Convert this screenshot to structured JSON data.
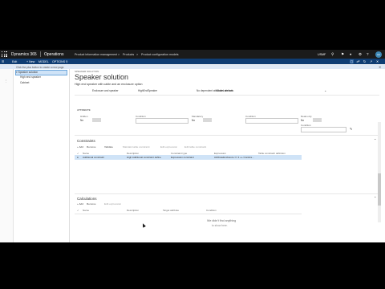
{
  "nav": {
    "brand": "Dynamics 365",
    "product": "Operations",
    "breadcrumb": [
      "Product information management",
      "Products",
      "Product configuration models"
    ],
    "company": "USMF",
    "avatar_initials": "AA",
    "icons": [
      "search-icon",
      "flag-icon",
      "bell-icon",
      "gear-icon",
      "help-icon"
    ]
  },
  "action_bar": {
    "edit": "Edit",
    "new": "+ New",
    "model": "MODEL",
    "options": "OPTIONS",
    "search_icon": "search-icon"
  },
  "message": "Click the plus button to create a new page.",
  "tree": {
    "items": [
      "Speaker solution",
      "High end speaker",
      "Cabinet"
    ]
  },
  "page": {
    "caption": "SPEAKER SOLUTION",
    "title": "Speaker solution",
    "subtitle": "High end speaker with cable and an enclosure option",
    "top_fields": [
      "Enclosure and speaker",
      "HighEndSpeaker",
      "",
      "No dependent attributes are set...",
      "Model attribute"
    ]
  },
  "attributes": {
    "header": "ATTRIBUTE",
    "fields": [
      {
        "label": "Hidden",
        "value": "No"
      },
      {
        "label": "Condition",
        "value": ""
      },
      {
        "label": "Mandatory",
        "value": "No"
      },
      {
        "label": "Condition",
        "value": ""
      },
      {
        "label": "Read-only",
        "value": "No"
      },
      {
        "label": "Condition",
        "value": ""
      }
    ]
  },
  "constraints": {
    "title": "Constraints",
    "toolbar": [
      "+ Add",
      "Remove",
      "Validate",
      "Maintain table constraint",
      "Edit expression",
      "Edit table constraint"
    ],
    "columns": [
      "Name",
      "Description",
      "Constraint type",
      "Expression",
      "Table constraint definition"
    ],
    "rows": [
      [
        "Additional constraint",
        "High Additional constraint define",
        "Expression constraint",
        "AttributeEnclosure == 1 ++ Constra...",
        ""
      ]
    ]
  },
  "calculations": {
    "title": "Calculations",
    "toolbar": [
      "+ Add",
      "Remove",
      "Edit expression"
    ],
    "columns": [
      "Name",
      "Description",
      "Target attribute",
      "Condition"
    ],
    "empty_text": "We didn't find anything",
    "empty_sub": "to show here."
  }
}
